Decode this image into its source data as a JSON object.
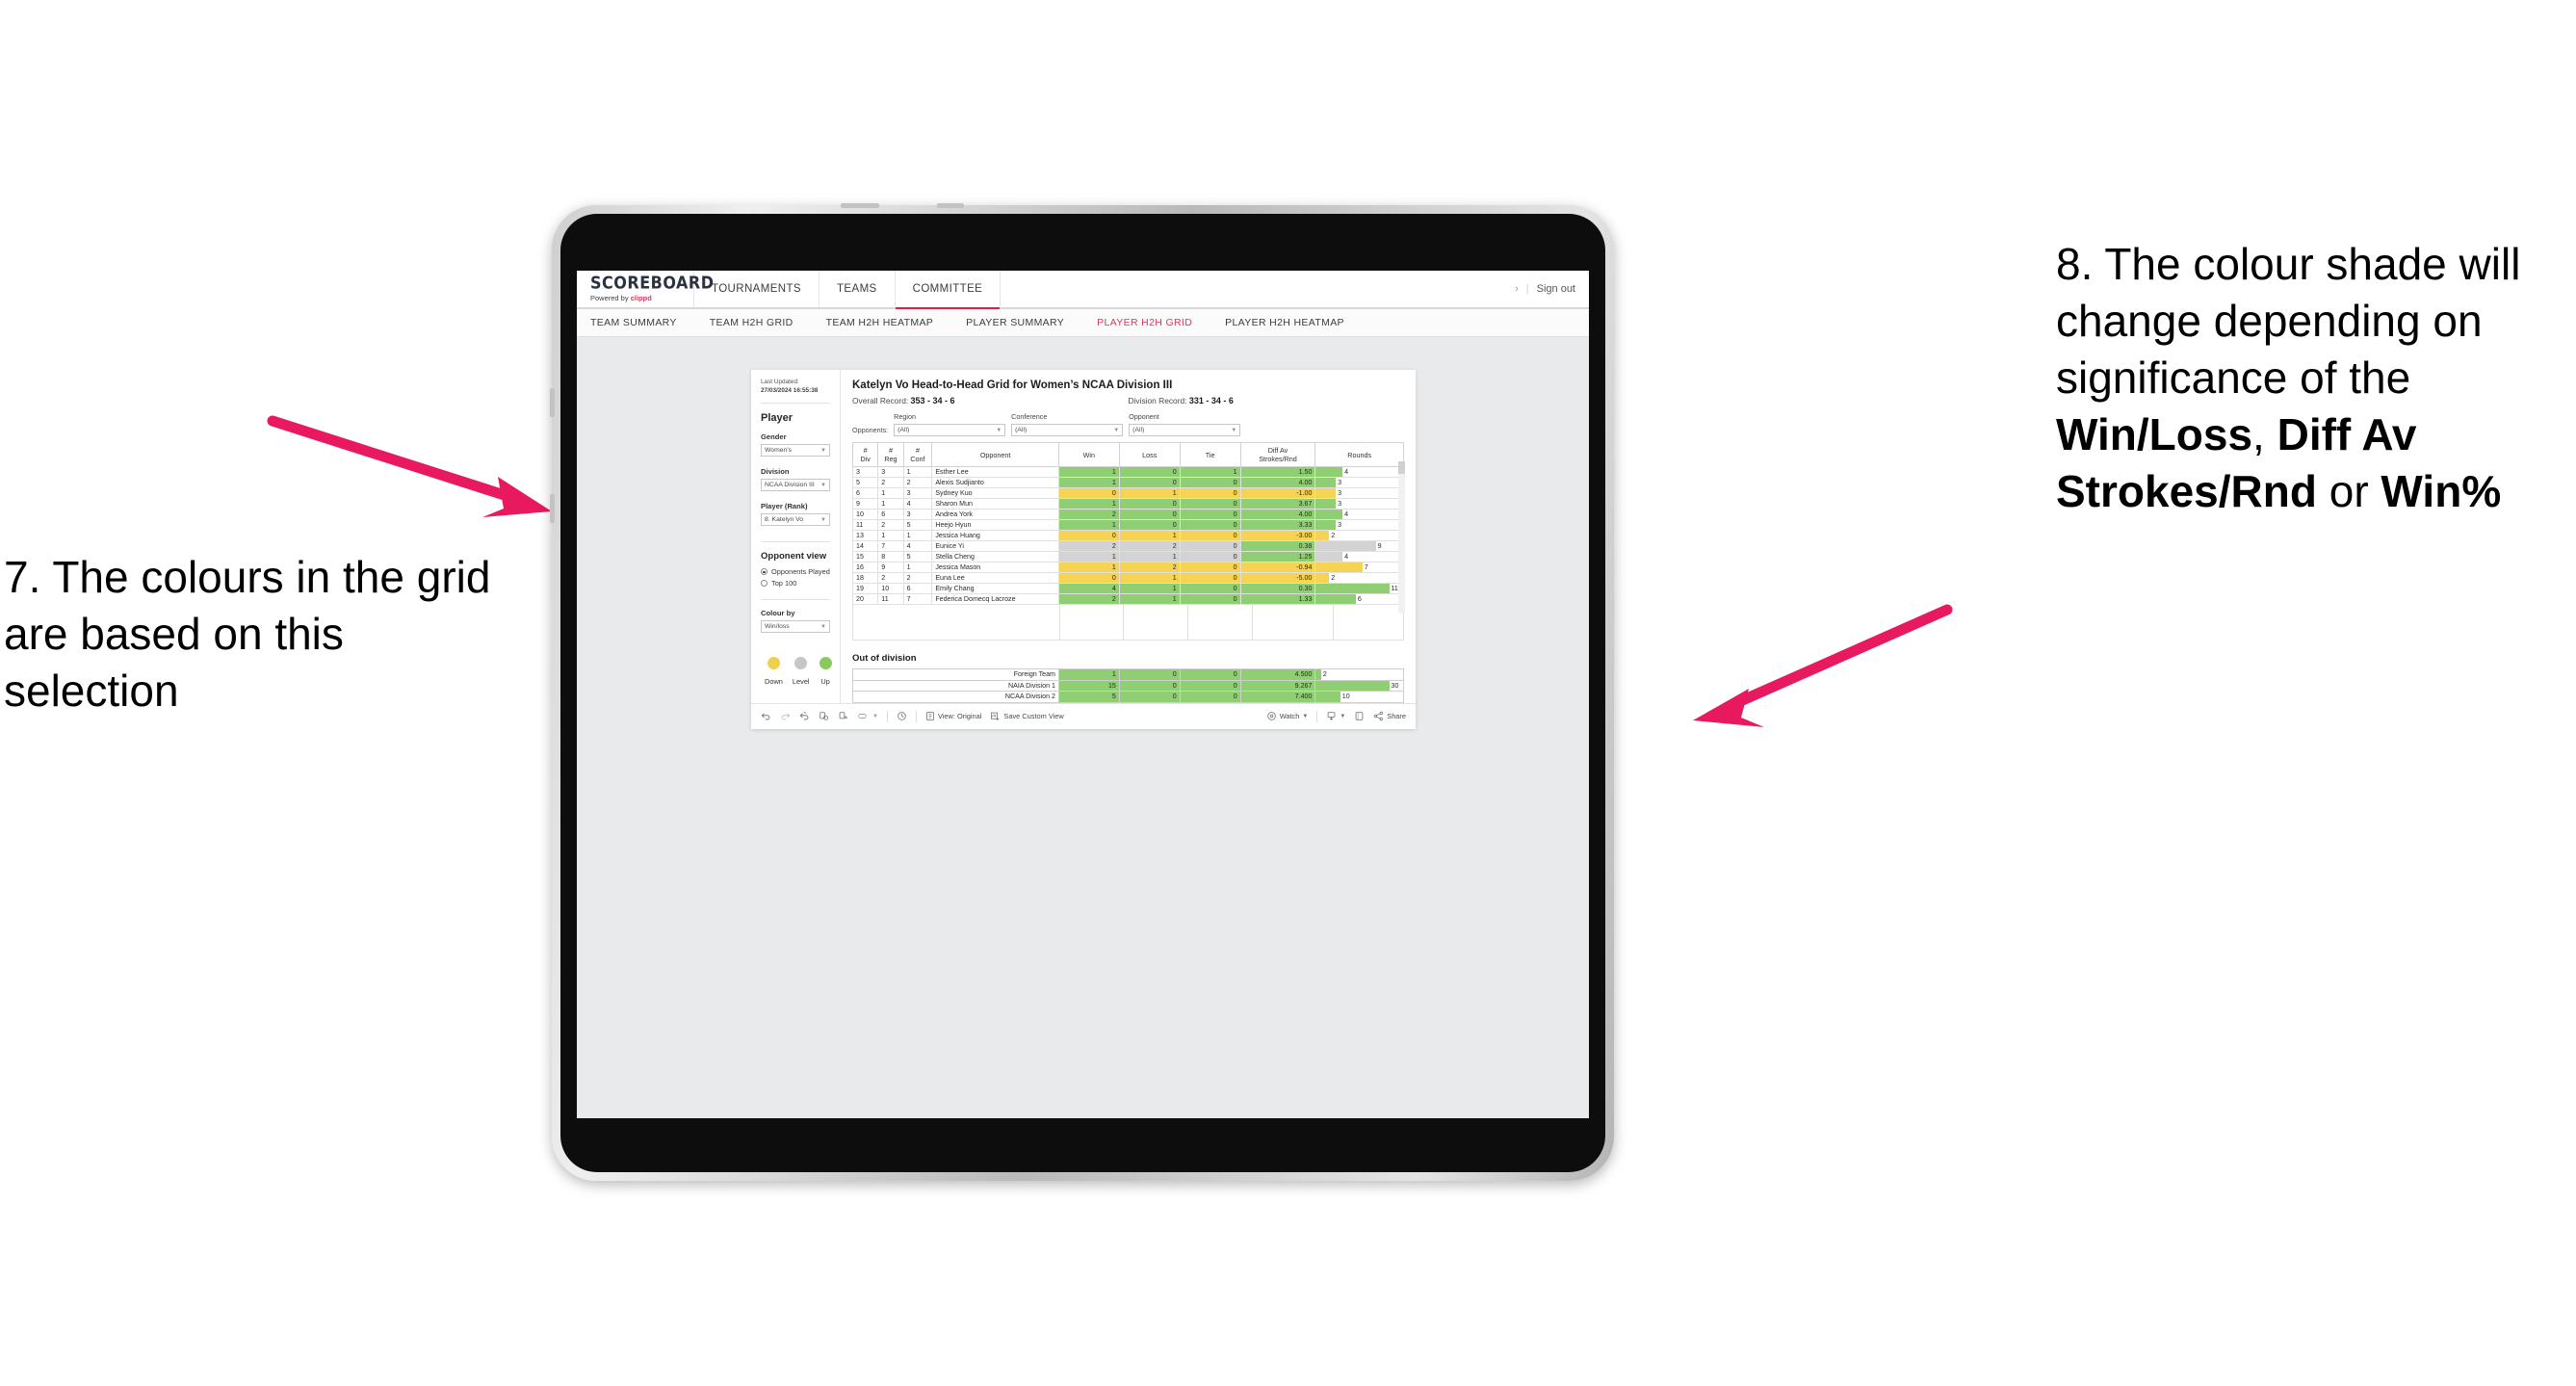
{
  "annotations": {
    "left": "7. The colours in the grid are based on this selection",
    "right_parts": [
      {
        "text": "8. The colour shade will change depending on significance of the ",
        "bold": false
      },
      {
        "text": "Win/Loss",
        "bold": true
      },
      {
        "text": ", ",
        "bold": false
      },
      {
        "text": "Diff Av Strokes/Rnd",
        "bold": true
      },
      {
        "text": " or ",
        "bold": false
      },
      {
        "text": "Win%",
        "bold": true
      }
    ],
    "arrow_color": "#e8195e"
  },
  "app": {
    "brand": {
      "title": "SCOREBOARD",
      "powered_prefix": "Powered by ",
      "powered_name": "clippd"
    },
    "nav": [
      {
        "label": "TOURNAMENTS",
        "active": false
      },
      {
        "label": "TEAMS",
        "active": false
      },
      {
        "label": "COMMITTEE",
        "active": true
      }
    ],
    "account": {
      "chevron": "›",
      "separator": "|",
      "sign_out": "Sign out"
    },
    "subnav": [
      {
        "label": "TEAM SUMMARY",
        "active": false
      },
      {
        "label": "TEAM H2H GRID",
        "active": false
      },
      {
        "label": "TEAM H2H HEATMAP",
        "active": false
      },
      {
        "label": "PLAYER SUMMARY",
        "active": false
      },
      {
        "label": "PLAYER H2H GRID",
        "active": true
      },
      {
        "label": "PLAYER H2H HEATMAP",
        "active": false
      }
    ]
  },
  "sidebar": {
    "last_updated_label": "Last Updated:",
    "last_updated_value": "27/03/2024 16:55:38",
    "player_heading": "Player",
    "fields": [
      {
        "label": "Gender",
        "value": "Women’s"
      },
      {
        "label": "Division",
        "value": "NCAA Division III"
      },
      {
        "label": "Player (Rank)",
        "value": "8. Katelyn Vo"
      }
    ],
    "opponent_view": {
      "heading": "Opponent view",
      "options": [
        {
          "label": "Opponents Played",
          "selected": true
        },
        {
          "label": "Top 100",
          "selected": false
        }
      ]
    },
    "colour_by": {
      "label": "Colour by",
      "value": "Win/loss"
    },
    "legend": [
      {
        "caption": "Down",
        "color": "#f2cf4a"
      },
      {
        "caption": "Level",
        "color": "#c4c6c9"
      },
      {
        "caption": "Up",
        "color": "#8bc95f"
      }
    ]
  },
  "main": {
    "title": "Katelyn Vo Head-to-Head Grid for Women’s NCAA Division III",
    "overall_record_label": "Overall Record:",
    "overall_record_value": "353 - 34 - 6",
    "division_record_label": "Division Record:",
    "division_record_value": "331 - 34 - 6",
    "opponents_label": "Opponents:",
    "opponent_filters": [
      {
        "label": "Region",
        "value": "(All)"
      },
      {
        "label": "Conference",
        "value": "(All)"
      },
      {
        "label": "Opponent",
        "value": "(All)"
      }
    ],
    "columns": [
      {
        "top": "#",
        "bottom": "Div"
      },
      {
        "top": "#",
        "bottom": "Reg"
      },
      {
        "top": "#",
        "bottom": "Conf"
      },
      {
        "top": "",
        "bottom": "Opponent"
      },
      {
        "top": "",
        "bottom": "Win"
      },
      {
        "top": "",
        "bottom": "Loss"
      },
      {
        "top": "",
        "bottom": "Tie"
      },
      {
        "top": "Diff Av",
        "bottom": "Strokes/Rnd"
      },
      {
        "top": "",
        "bottom": "Rounds"
      }
    ],
    "rows": [
      {
        "div": "3",
        "reg": "3",
        "conf": "1",
        "opponent": "Esther Lee",
        "win": "1",
        "loss": "0",
        "tie": "1",
        "diff": "1.50",
        "rounds": "4",
        "color": "green"
      },
      {
        "div": "5",
        "reg": "2",
        "conf": "2",
        "opponent": "Alexis Sudjianto",
        "win": "1",
        "loss": "0",
        "tie": "0",
        "diff": "4.00",
        "rounds": "3",
        "color": "green"
      },
      {
        "div": "6",
        "reg": "1",
        "conf": "3",
        "opponent": "Sydney Kuo",
        "win": "0",
        "loss": "1",
        "tie": "0",
        "diff": "-1.00",
        "rounds": "3",
        "color": "yellow"
      },
      {
        "div": "9",
        "reg": "1",
        "conf": "4",
        "opponent": "Sharon Mun",
        "win": "1",
        "loss": "0",
        "tie": "0",
        "diff": "3.67",
        "rounds": "3",
        "color": "green"
      },
      {
        "div": "10",
        "reg": "6",
        "conf": "3",
        "opponent": "Andrea York",
        "win": "2",
        "loss": "0",
        "tie": "0",
        "diff": "4.00",
        "rounds": "4",
        "color": "green"
      },
      {
        "div": "11",
        "reg": "2",
        "conf": "5",
        "opponent": "Heejo Hyun",
        "win": "1",
        "loss": "0",
        "tie": "0",
        "diff": "3.33",
        "rounds": "3",
        "color": "green"
      },
      {
        "div": "13",
        "reg": "1",
        "conf": "1",
        "opponent": "Jessica Huang",
        "win": "0",
        "loss": "1",
        "tie": "0",
        "diff": "-3.00",
        "rounds": "2",
        "color": "yellow"
      },
      {
        "div": "14",
        "reg": "7",
        "conf": "4",
        "opponent": "Eunice Yi",
        "win": "2",
        "loss": "2",
        "tie": "0",
        "diff": "0.38",
        "rounds": "9",
        "color": "grey",
        "diff_color": "green"
      },
      {
        "div": "15",
        "reg": "8",
        "conf": "5",
        "opponent": "Stella Cheng",
        "win": "1",
        "loss": "1",
        "tie": "0",
        "diff": "1.25",
        "rounds": "4",
        "color": "grey",
        "diff_color": "green"
      },
      {
        "div": "16",
        "reg": "9",
        "conf": "1",
        "opponent": "Jessica Mason",
        "win": "1",
        "loss": "2",
        "tie": "0",
        "diff": "-0.94",
        "rounds": "7",
        "color": "yellow"
      },
      {
        "div": "18",
        "reg": "2",
        "conf": "2",
        "opponent": "Euna Lee",
        "win": "0",
        "loss": "1",
        "tie": "0",
        "diff": "-5.00",
        "rounds": "2",
        "color": "yellow"
      },
      {
        "div": "19",
        "reg": "10",
        "conf": "6",
        "opponent": "Emily Chang",
        "win": "4",
        "loss": "1",
        "tie": "0",
        "diff": "0.30",
        "rounds": "11",
        "color": "green"
      },
      {
        "div": "20",
        "reg": "11",
        "conf": "7",
        "opponent": "Federica Domecq Lacroze",
        "win": "2",
        "loss": "1",
        "tie": "0",
        "diff": "1.33",
        "rounds": "6",
        "color": "green"
      }
    ],
    "out_of_division": {
      "title": "Out of division",
      "rows": [
        {
          "name": "Foreign Team",
          "win": "1",
          "loss": "0",
          "tie": "0",
          "diff": "4.500",
          "rounds": "2",
          "color": "green"
        },
        {
          "name": "NAIA Division 1",
          "win": "15",
          "loss": "0",
          "tie": "0",
          "diff": "9.267",
          "rounds": "30",
          "color": "green"
        },
        {
          "name": "NCAA Division 2",
          "win": "5",
          "loss": "0",
          "tie": "0",
          "diff": "7.400",
          "rounds": "10",
          "color": "green"
        }
      ]
    }
  },
  "toolbar": {
    "view_label": "View: Original",
    "save_label": "Save Custom View",
    "watch_label": "Watch",
    "share_label": "Share"
  }
}
